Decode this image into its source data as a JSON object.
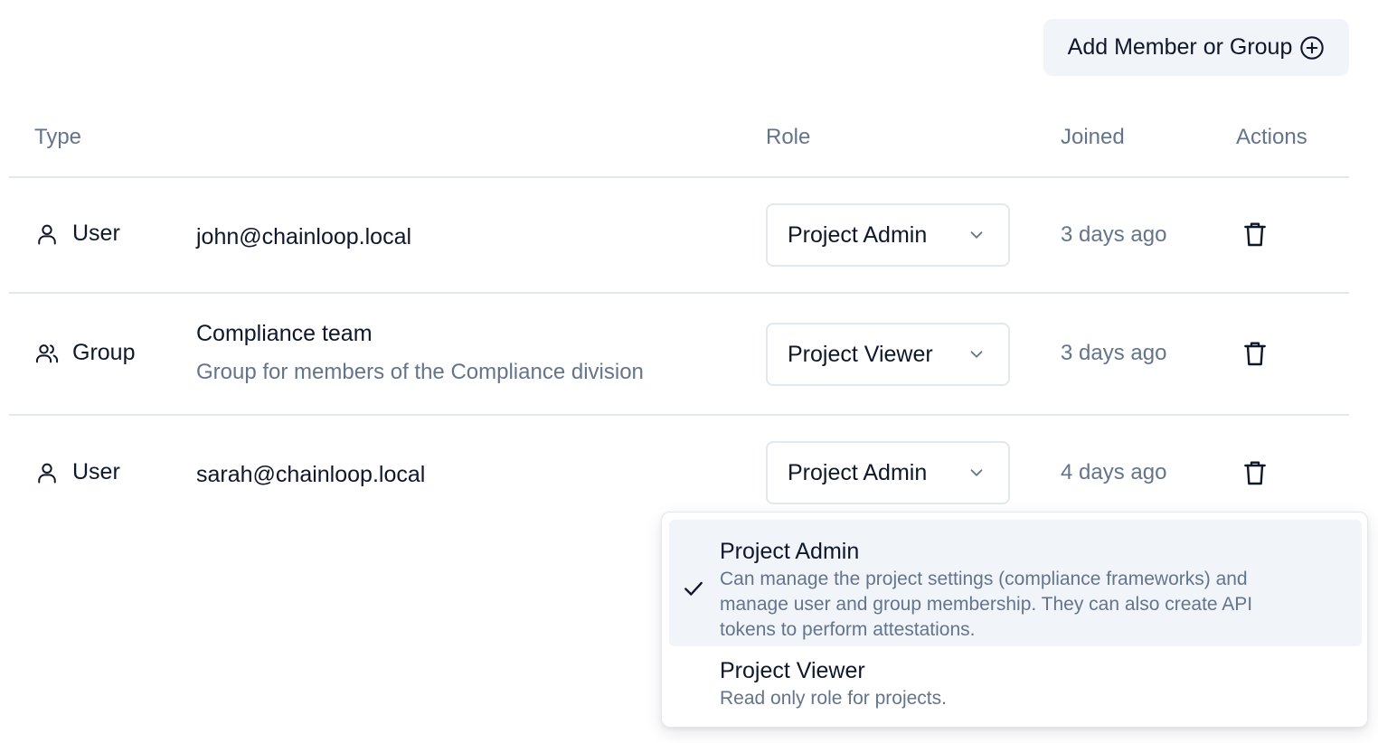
{
  "toolbar": {
    "add_label": "Add Member or Group"
  },
  "table": {
    "headers": {
      "type": "Type",
      "role": "Role",
      "joined": "Joined",
      "actions": "Actions"
    },
    "rows": [
      {
        "type": "User",
        "name": "john@chainloop.local",
        "description": "",
        "role": "Project Admin",
        "joined": "3 days ago"
      },
      {
        "type": "Group",
        "name": "Compliance team",
        "description": "Group for members of the Compliance division",
        "role": "Project Viewer",
        "joined": "3 days ago"
      },
      {
        "type": "User",
        "name": "sarah@chainloop.local",
        "description": "",
        "role": "Project Admin",
        "joined": "4 days ago"
      }
    ]
  },
  "role_dropdown": {
    "options": [
      {
        "label": "Project Admin",
        "description": "Can manage the project settings (compliance frameworks) and manage user and group membership. They can also create API tokens to perform attestations.",
        "selected": true
      },
      {
        "label": "Project Viewer",
        "description": "Read only role for projects.",
        "selected": false
      }
    ]
  },
  "icons": {
    "add": "plus-circle-icon",
    "user": "user-icon",
    "group": "users-icon",
    "chevron": "chevron-down-icon",
    "delete": "trash-icon",
    "check": "check-icon"
  },
  "colors": {
    "text": "#0f172a",
    "muted": "#64748b",
    "border": "#e2e8f0",
    "button_bg": "#f1f5f9"
  }
}
